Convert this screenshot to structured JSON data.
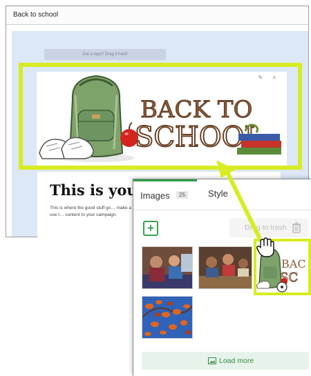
{
  "editor": {
    "title": "Back to school",
    "logo_drop": "Got a logo? Drag it here!",
    "heading": "This is your m",
    "body_text": "This is where the good stuff go… make a ruckus! You can use t… content to your campaign."
  },
  "banner": {
    "title_line1": "BACK TO",
    "title_line2": "SCHOOL",
    "tools": "✎ ×"
  },
  "panel": {
    "tabs": [
      {
        "label": "Images",
        "count": "25"
      },
      {
        "label": "Style"
      }
    ],
    "add_label": "+",
    "trash_label": "Drag to trash",
    "load_more": "Load more"
  },
  "colors": {
    "highlight": "#d7ec22",
    "accent_green": "#35a14f",
    "canvas_bg": "#dce8f8"
  }
}
